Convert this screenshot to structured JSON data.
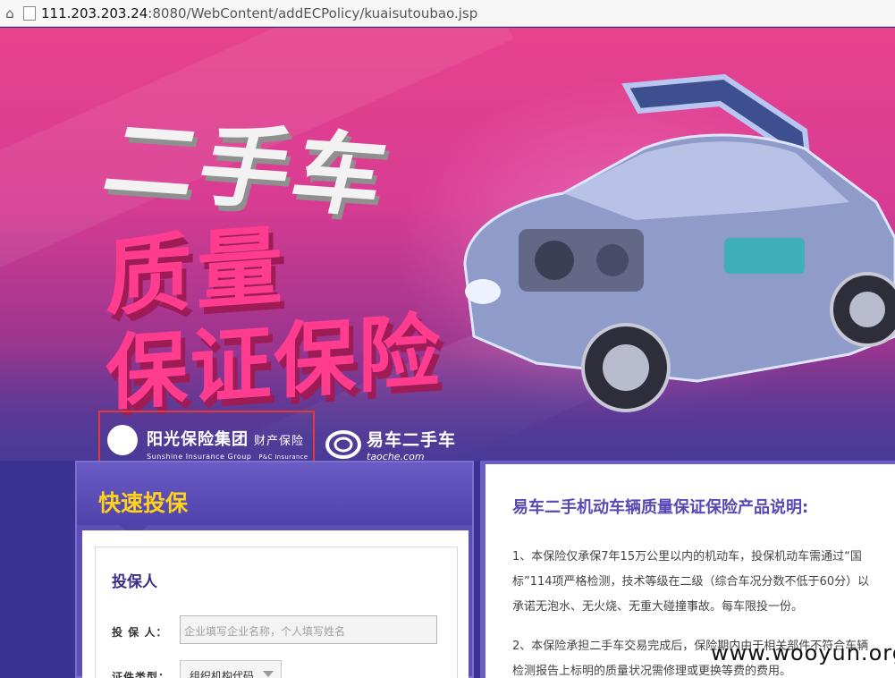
{
  "browser": {
    "url_host": "111.203.203.24",
    "url_rest": ":8080/WebContent/addECPolicy/kuaisutoubao.jsp"
  },
  "banner": {
    "headline_1": "二手车",
    "headline_2": "质量",
    "headline_3": "保证保险"
  },
  "logos": {
    "sunshine_cn": "阳光保险集团",
    "sunshine_sub_cn": "财产保险",
    "sunshine_en": "Sunshine Insurance Group",
    "sunshine_sub_en": "P&C Insurance",
    "taoche_cn": "易车二手车",
    "taoche_en": "taoche.com"
  },
  "form": {
    "title": "快速投保",
    "section_title": "投保人",
    "applicant_label": "投 保 人：",
    "applicant_placeholder": "企业填写企业名称，个人填写姓名",
    "id_type_label": "证件类型：",
    "id_type_value": "组织机构代码"
  },
  "info": {
    "title": "易车二手机动车辆质量保证保险产品说明:",
    "p1_line1": "1、本保险仅承保7年15万公里以内的机动车，投保机动车需通过“国",
    "p1_line2": "标”114项严格检测，技术等级在二级（综合车况分数不低于60分）以",
    "p1_line3": "承诺无泡水、无火烧、无重大碰撞事故。每车限投一份。",
    "p2_line1": "2、本保险承担二手车交易完成后，保险期内由于相关部件不符合车辆",
    "p2_line2": "检测报告上标明的质量状况需修理或更换等费的费用。"
  },
  "watermark": "www.wooyun.org",
  "colors": {
    "banner_pink": "#e8428f",
    "headline_pink": "#ff3c8e",
    "panel_purple": "#5d4fb8",
    "form_title_yellow": "#ffd21c",
    "info_title_purple": "#5a48b5",
    "highlight_red": "#e23a3a"
  }
}
